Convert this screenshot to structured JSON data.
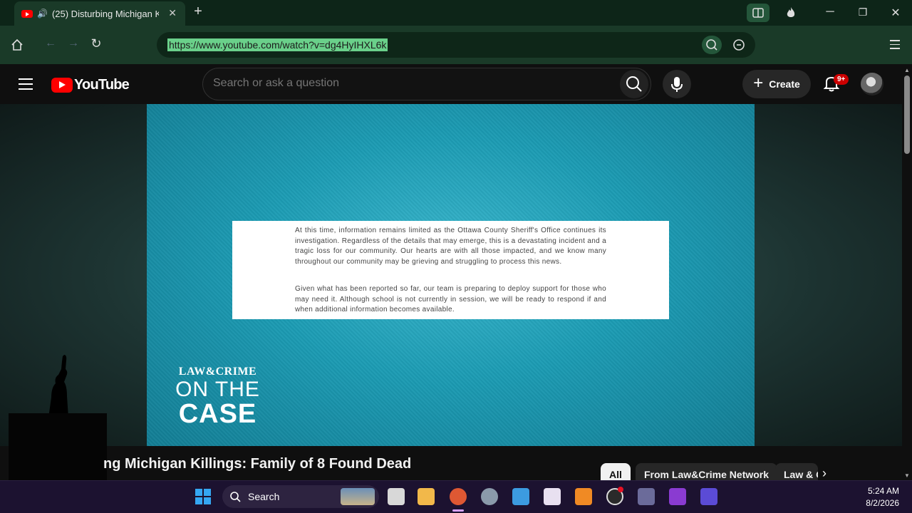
{
  "browser": {
    "tab_title": "(25) Disturbing Michigan K",
    "url": "https://www.youtube.com/watch?v=dg4HyIHXL6k"
  },
  "youtube": {
    "logo_text": "YouTube",
    "search_placeholder": "Search or ask a question",
    "create_label": "Create",
    "notification_count": "9+"
  },
  "video": {
    "statement_paragraphs": [
      "At this time, information remains limited as the Ottawa County Sheriff's Office continues its investigation. Regardless of the details that may emerge, this is a devastating incident and a tragic loss for our community. Our hearts are with all those impacted, and we know many throughout our community may be grieving and struggling to process this news.",
      "Given what has been reported so far, our team is preparing to deploy support for those who may need it. Although school is not currently in session, we will be ready to respond if and when additional information becomes available."
    ],
    "watermark": {
      "top": "LAW&CRIME",
      "middle": "ON THE",
      "bottom": "CASE"
    },
    "title": "ng Michigan Killings: Family of 8 Found Dead"
  },
  "chips": {
    "all": "All",
    "from_channel": "From Law&Crime Network",
    "law": "Law & C"
  },
  "taskbar": {
    "search_label": "Search",
    "time": "5:24 AM",
    "date": "8/2/2026"
  },
  "colors": {
    "browser_chrome": "#1a3a28",
    "youtube_red": "#ff0000",
    "video_teal": "#1c9cb4",
    "taskbar": "#1c1230"
  }
}
